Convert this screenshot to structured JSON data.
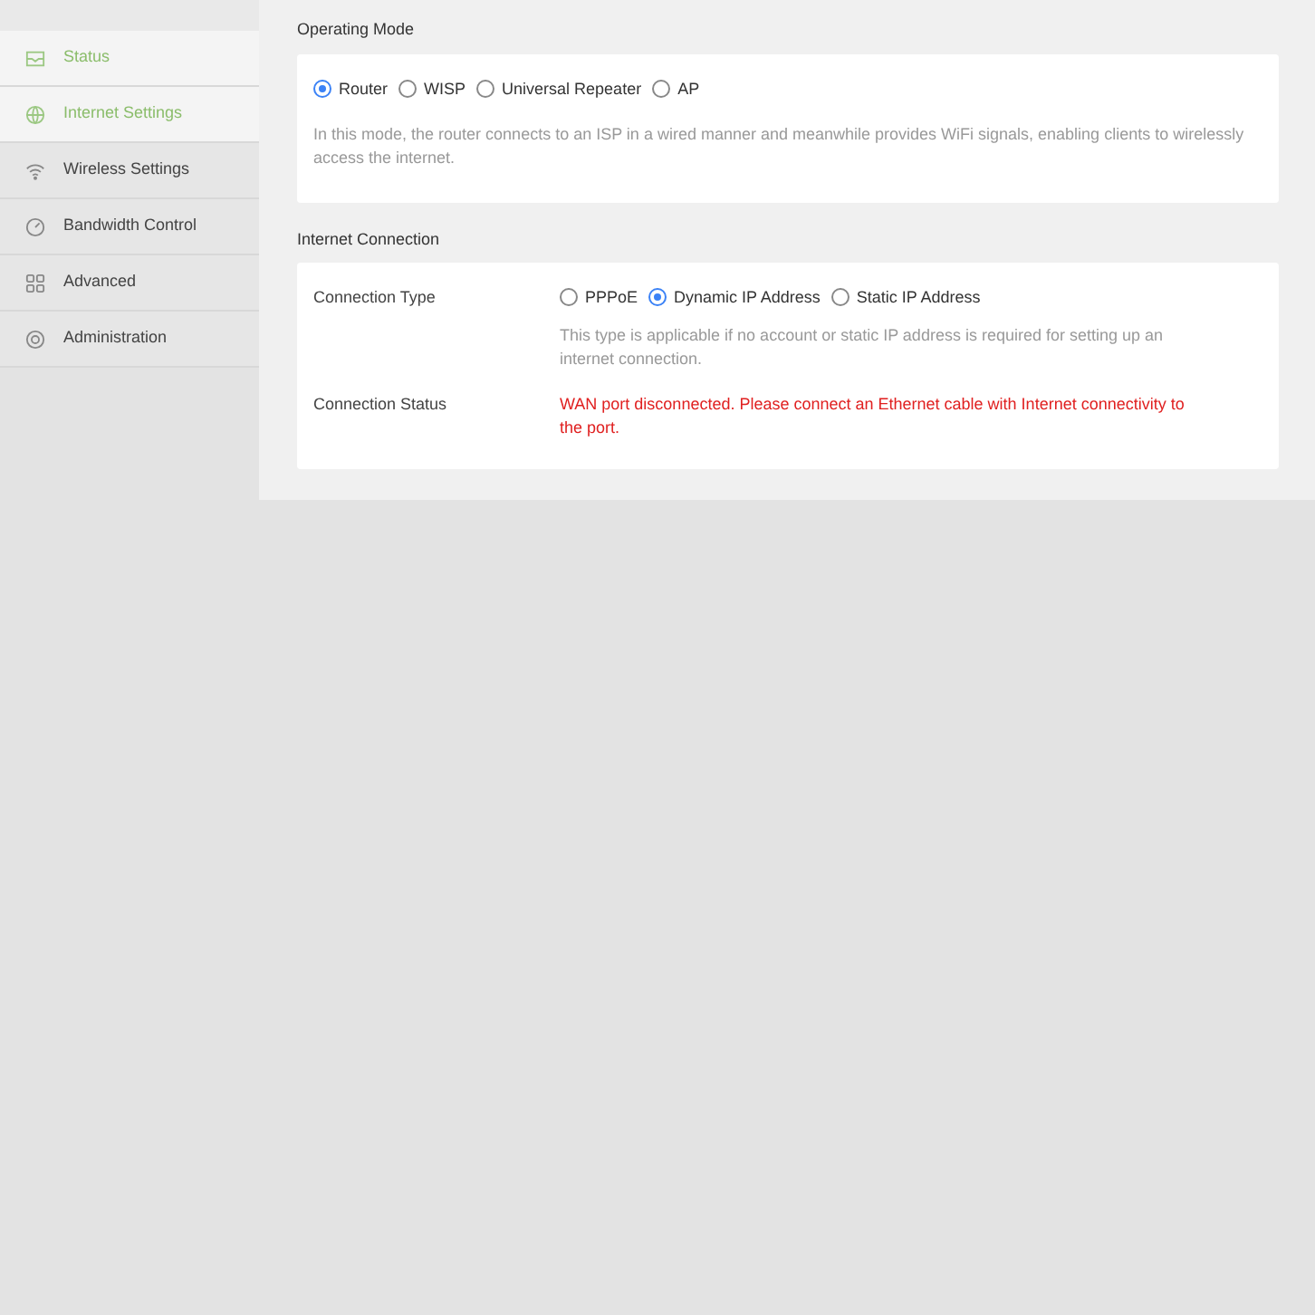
{
  "sidebar": {
    "items": [
      {
        "label": "Status",
        "kind": "status",
        "selected": true
      },
      {
        "label": "Internet Settings",
        "kind": "internet",
        "selected": true
      },
      {
        "label": "Wireless Settings",
        "kind": "wireless",
        "selected": false
      },
      {
        "label": "Bandwidth Control",
        "kind": "bandwidth",
        "selected": false
      },
      {
        "label": "Advanced",
        "kind": "advanced",
        "selected": false
      },
      {
        "label": "Administration",
        "kind": "administration",
        "selected": false
      }
    ]
  },
  "operating_mode": {
    "title": "Operating Mode",
    "options": [
      {
        "label": "Router",
        "selected": true
      },
      {
        "label": "WISP",
        "selected": false
      },
      {
        "label": "Universal Repeater",
        "selected": false
      },
      {
        "label": "AP",
        "selected": false
      }
    ],
    "description": "In this mode, the router connects to an ISP in a wired manner and meanwhile provides WiFi signals, enabling clients to wirelessly access the internet."
  },
  "internet_connection": {
    "title": "Internet Connection",
    "connection_type": {
      "label": "Connection Type",
      "options": [
        {
          "label": "PPPoE",
          "selected": false
        },
        {
          "label": "Dynamic IP Address",
          "selected": true
        },
        {
          "label": "Static IP Address",
          "selected": false
        }
      ],
      "description": "This type is applicable if no account or static IP address is required for setting up an internet connection."
    },
    "connection_status": {
      "label": "Connection Status",
      "value": "WAN port disconnected. Please connect an Ethernet cable with Internet connectivity to the port."
    }
  }
}
